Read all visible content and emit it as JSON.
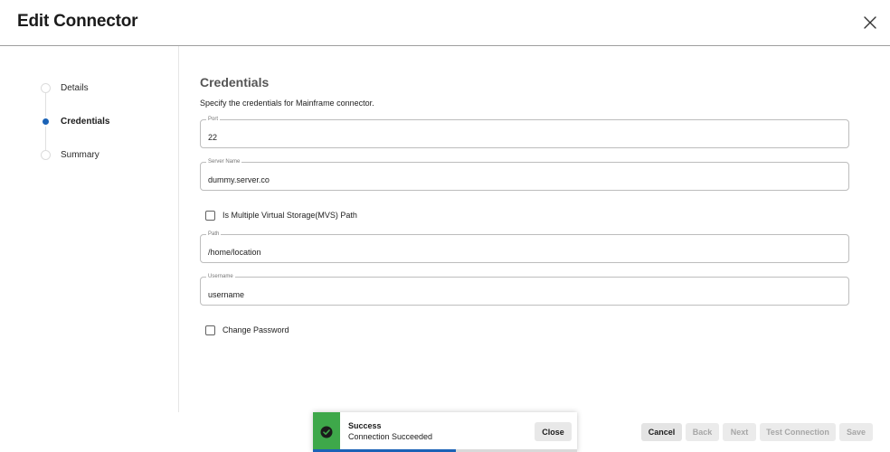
{
  "header": {
    "title": "Edit Connector",
    "close_icon": "close-icon"
  },
  "stepper": {
    "steps": [
      {
        "label": "Details",
        "state": "inactive"
      },
      {
        "label": "Credentials",
        "state": "active"
      },
      {
        "label": "Summary",
        "state": "inactive"
      }
    ]
  },
  "form": {
    "section_title": "Credentials",
    "description": "Specify the credentials for Mainframe connector.",
    "port": {
      "label": "Port",
      "value": "22"
    },
    "server_name": {
      "label": "Server Name",
      "value": "dummy.server.co"
    },
    "mvs_checkbox": {
      "label": "Is Multiple Virtual Storage(MVS) Path",
      "checked": false
    },
    "path": {
      "label": "Path",
      "value": "/home/location"
    },
    "username": {
      "label": "Username",
      "value": "username"
    },
    "change_password": {
      "label": "Change Password",
      "checked": false
    }
  },
  "toast": {
    "title": "Success",
    "message": "Connection Succeeded",
    "close_label": "Close",
    "icon": "check-circle-icon",
    "progress": 0.54,
    "accent_color": "#3ea84a",
    "progress_color": "#1a62b6"
  },
  "footer": {
    "cancel_label": "Cancel",
    "back_label": "Back",
    "next_label": "Next",
    "test_connection_label": "Test Connection",
    "save_label": "Save"
  },
  "colors": {
    "active_step": "#1a62b6",
    "success": "#3ea84a"
  }
}
